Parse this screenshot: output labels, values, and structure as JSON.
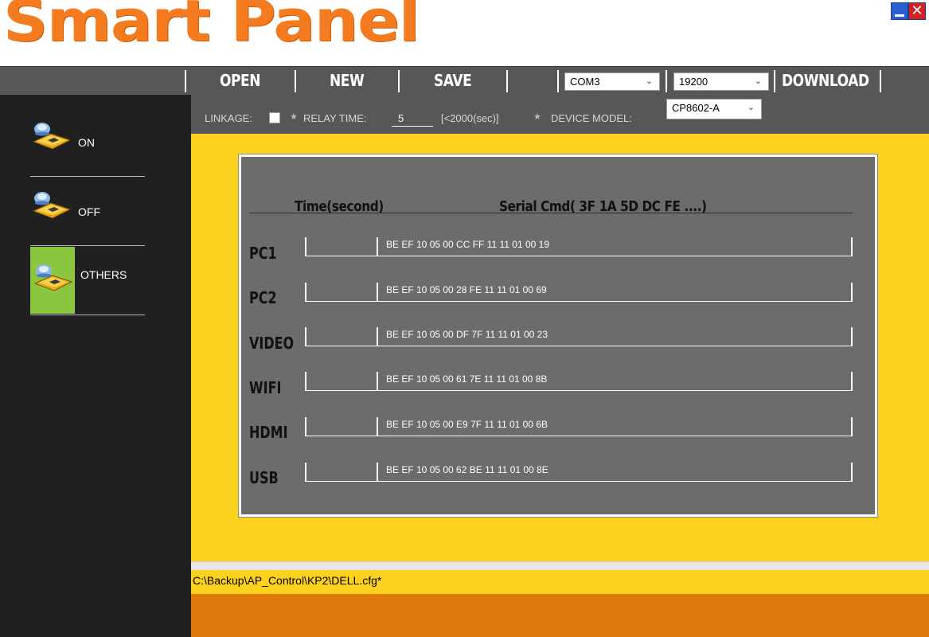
{
  "app": {
    "title": "Smart Panel"
  },
  "toolbar": {
    "open_label": "OPEN",
    "new_label": "NEW",
    "save_label": "SAVE",
    "port_value": "COM3",
    "baud_value": "19200",
    "download_label": "DOWNLOAD"
  },
  "sidebar": {
    "items": [
      {
        "label": "ON",
        "icon": "device-on-icon"
      },
      {
        "label": "OFF",
        "icon": "device-off-icon"
      },
      {
        "label": "OTHERS",
        "icon": "device-others-icon",
        "selected": true
      }
    ]
  },
  "options": {
    "linkage_label": "LINKAGE:",
    "linkage_checked": false,
    "relay_time_label": "RELAY TIME:",
    "relay_time_value": "5",
    "relay_time_hint": "[<2000(sec)]",
    "device_model_label": "DEVICE MODEL:",
    "device_model_value": "CP8602-A"
  },
  "table": {
    "col_time": "Time(second)",
    "col_cmd": "Serial Cmd( 3F  1A  5D  DC  FE ....)",
    "rows": [
      {
        "label": "PC1",
        "time": "",
        "cmd": "BE EF 10 05 00 CC FF 11 11 01 00 19"
      },
      {
        "label": "PC2",
        "time": "",
        "cmd": "BE EF 10 05 00 28 FE 11 11 01 00 69"
      },
      {
        "label": "VIDEO",
        "time": "",
        "cmd": "BE EF 10 05 00 DF 7F 11 11 01 00 23"
      },
      {
        "label": "WIFI",
        "time": "",
        "cmd": "BE EF 10 05 00 61 7E 11 11 01 00 8B"
      },
      {
        "label": "HDMI",
        "time": "",
        "cmd": "BE EF 10 05 00 E9 7F 11 11 01 00 6B"
      },
      {
        "label": "USB",
        "time": "",
        "cmd": "BE EF 10 05 00 62 BE 11 11 01 00 8E"
      }
    ]
  },
  "status": {
    "path": "C:\\Backup\\AP_Control\\KP2\\DELL.cfg*"
  },
  "colors": {
    "logo": "#f47b20",
    "toolbar": "#575757",
    "sidebar": "#202020",
    "work_area": "#fdd21f",
    "panel": "#6c6c6c",
    "footer": "#e07a0d",
    "selected_item": "#8cc63f"
  }
}
